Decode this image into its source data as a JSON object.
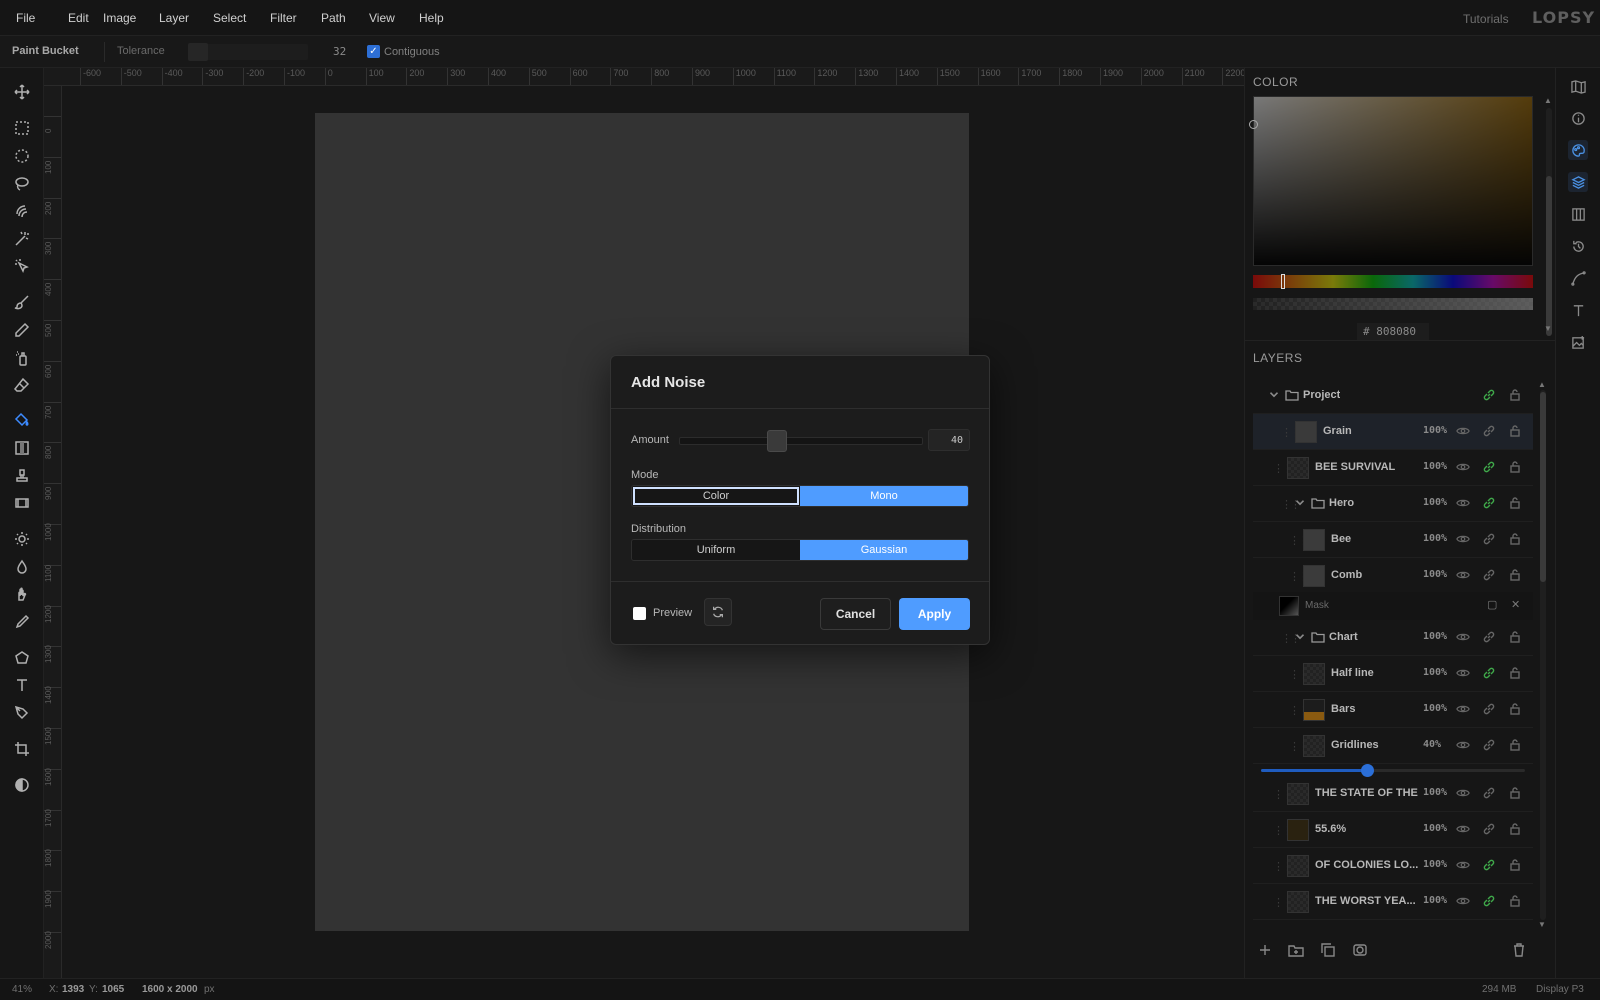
{
  "menu": [
    "File",
    "Edit",
    "Image",
    "Layer",
    "Select",
    "Filter",
    "Path",
    "View",
    "Help"
  ],
  "header": {
    "tutorials": "Tutorials",
    "logo": "LOPSY"
  },
  "options": {
    "tool_name": "Paint Bucket",
    "tolerance_label": "Tolerance",
    "tolerance_value": "32",
    "contiguous_label": "Contiguous",
    "contiguous_checked": true
  },
  "tools": [
    "move-icon",
    "rect-select-icon",
    "ellipse-select-icon",
    "lasso-icon",
    "quick-select-icon",
    "magic-wand-icon",
    "object-select-icon",
    "brush-icon",
    "pencil-icon",
    "spray-icon",
    "eraser-icon",
    "paint-bucket-icon",
    "gradient-icon",
    "stamp-icon",
    "film-icon",
    "dodge-icon",
    "burn-icon",
    "smudge-icon",
    "eyedropper-icon",
    "polygon-icon",
    "text-icon",
    "pen-icon",
    "crop-icon",
    "adjust-icon"
  ],
  "ruler": {
    "h": [
      "-600",
      "-500",
      "-400",
      "-300",
      "-200",
      "-100",
      "0",
      "100",
      "200",
      "300",
      "400",
      "500",
      "600",
      "700",
      "800",
      "900",
      "1000",
      "1100",
      "1200",
      "1300",
      "1400",
      "1500",
      "1600",
      "1700",
      "1800",
      "1900",
      "2000",
      "2100",
      "2200"
    ],
    "v": [
      "0",
      "100",
      "200",
      "300",
      "400",
      "500",
      "600",
      "700",
      "800",
      "900",
      "1000",
      "1100",
      "1200",
      "1300",
      "1400",
      "1500",
      "1600",
      "1700",
      "1800",
      "1900",
      "2000"
    ]
  },
  "color_panel": {
    "title": "COLOR",
    "hex": "# 808080"
  },
  "layers_panel": {
    "title": "LAYERS",
    "rows": [
      {
        "name": "Project",
        "opacity": "",
        "kind": "folder"
      },
      {
        "name": "Grain",
        "opacity": "100%",
        "kind": "layer"
      },
      {
        "name": "BEE SURVIVAL",
        "opacity": "100%",
        "kind": "layer"
      },
      {
        "name": "Hero",
        "opacity": "100%",
        "kind": "folder"
      },
      {
        "name": "Bee",
        "opacity": "100%",
        "kind": "layer"
      },
      {
        "name": "Comb",
        "opacity": "100%",
        "kind": "layer"
      },
      {
        "name": "Chart",
        "opacity": "100%",
        "kind": "folder"
      },
      {
        "name": "Half line",
        "opacity": "100%",
        "kind": "layer"
      },
      {
        "name": "Bars",
        "opacity": "100%",
        "kind": "layer"
      },
      {
        "name": "Gridlines",
        "opacity": "40%",
        "kind": "layer"
      },
      {
        "name": "THE STATE OF THE",
        "opacity": "100%",
        "kind": "layer"
      },
      {
        "name": "55.6%",
        "opacity": "100%",
        "kind": "layer"
      },
      {
        "name": "OF COLONIES LO...",
        "opacity": "100%",
        "kind": "layer"
      },
      {
        "name": "THE WORST YEA...",
        "opacity": "100%",
        "kind": "layer"
      }
    ],
    "mask_label": "Mask",
    "gridlines_opacity_value": 0.4
  },
  "side_icons": [
    "map-icon",
    "info-icon",
    "palette-icon",
    "layers-icon",
    "columns-icon",
    "history-icon",
    "curve-icon",
    "type-icon",
    "image-plus-icon"
  ],
  "status": {
    "zoom": "41%",
    "x_label": "X:",
    "x": "1393",
    "y_label": "Y:",
    "y": "1065",
    "dims": "1600 x 2000",
    "unit": "px",
    "memory": "294 MB",
    "profile": "Display P3"
  },
  "dialog": {
    "title": "Add Noise",
    "amount_label": "Amount",
    "amount_value": "40",
    "amount_fraction": 0.4,
    "mode_label": "Mode",
    "mode_options": [
      "Color",
      "Mono"
    ],
    "mode_selected": "Mono",
    "distribution_label": "Distribution",
    "distribution_options": [
      "Uniform",
      "Gaussian"
    ],
    "distribution_selected": "Gaussian",
    "preview_label": "Preview",
    "cancel": "Cancel",
    "apply": "Apply"
  }
}
